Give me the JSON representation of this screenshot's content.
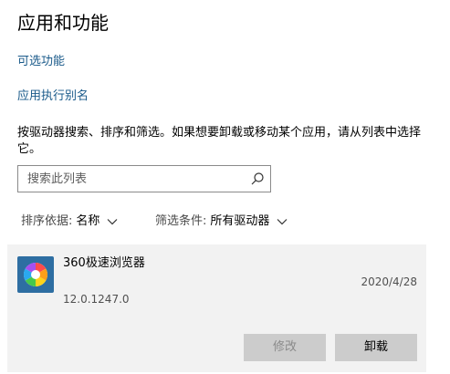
{
  "page": {
    "title": "应用和功能",
    "links": {
      "optional_features": "可选功能",
      "app_aliases": "应用执行别名"
    },
    "description": "按驱动器搜索、排序和筛选。如果想要卸载或移动某个应用，请从列表中选择它。"
  },
  "search": {
    "placeholder": "搜索此列表",
    "value": "",
    "icon": "search-icon"
  },
  "filters": {
    "sort": {
      "label": "排序依据:",
      "value": "名称",
      "icon": "chevron-down-icon"
    },
    "drive": {
      "label": "筛选条件:",
      "value": "所有驱动器",
      "icon": "chevron-down-icon"
    }
  },
  "apps": [
    {
      "name": "360极速浏览器",
      "date": "2020/4/28",
      "version": "12.0.1247.0",
      "icon": "360-browser-icon",
      "buttons": {
        "modify": "修改",
        "uninstall": "卸载"
      }
    }
  ],
  "colors": {
    "link": "#1a5a8a",
    "card_bg": "#f2f2f2",
    "button_bg": "#cccccc"
  }
}
